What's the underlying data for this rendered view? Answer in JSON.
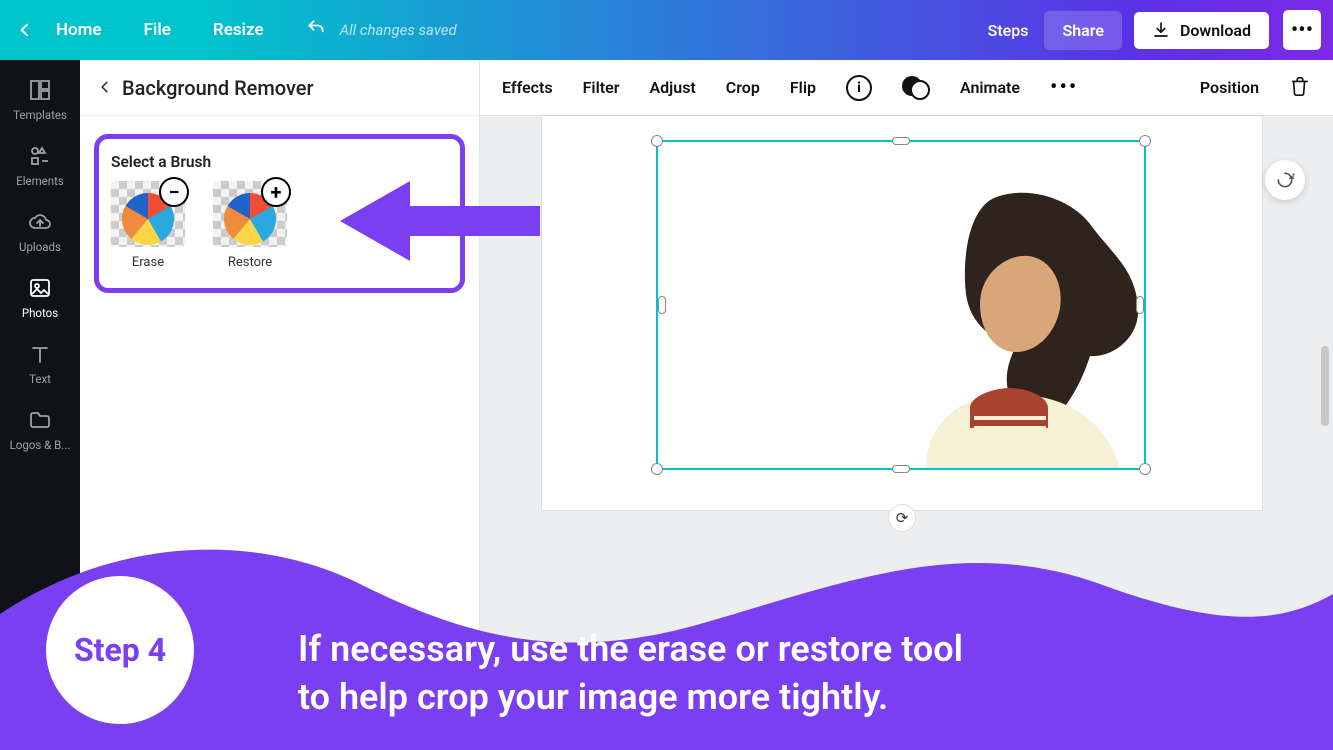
{
  "topbar": {
    "home": "Home",
    "file": "File",
    "resize": "Resize",
    "saved": "All changes saved",
    "steps": "Steps",
    "share": "Share",
    "download": "Download"
  },
  "rail": {
    "templates": "Templates",
    "elements": "Elements",
    "uploads": "Uploads",
    "photos": "Photos",
    "text": "Text",
    "logos": "Logos & B..."
  },
  "panel": {
    "title": "Background Remover",
    "brush_heading": "Select a Brush",
    "erase": "Erase",
    "restore": "Restore"
  },
  "ctx": {
    "effects": "Effects",
    "filter": "Filter",
    "adjust": "Adjust",
    "crop": "Crop",
    "flip": "Flip",
    "animate": "Animate",
    "position": "Position"
  },
  "banner": {
    "step_label": "Step 4",
    "text_line1": "If necessary, use the erase or restore tool",
    "text_line2": "to help crop your image more tightly."
  },
  "colors": {
    "accent": "#7b3ff2",
    "selection": "#00c4cc"
  }
}
